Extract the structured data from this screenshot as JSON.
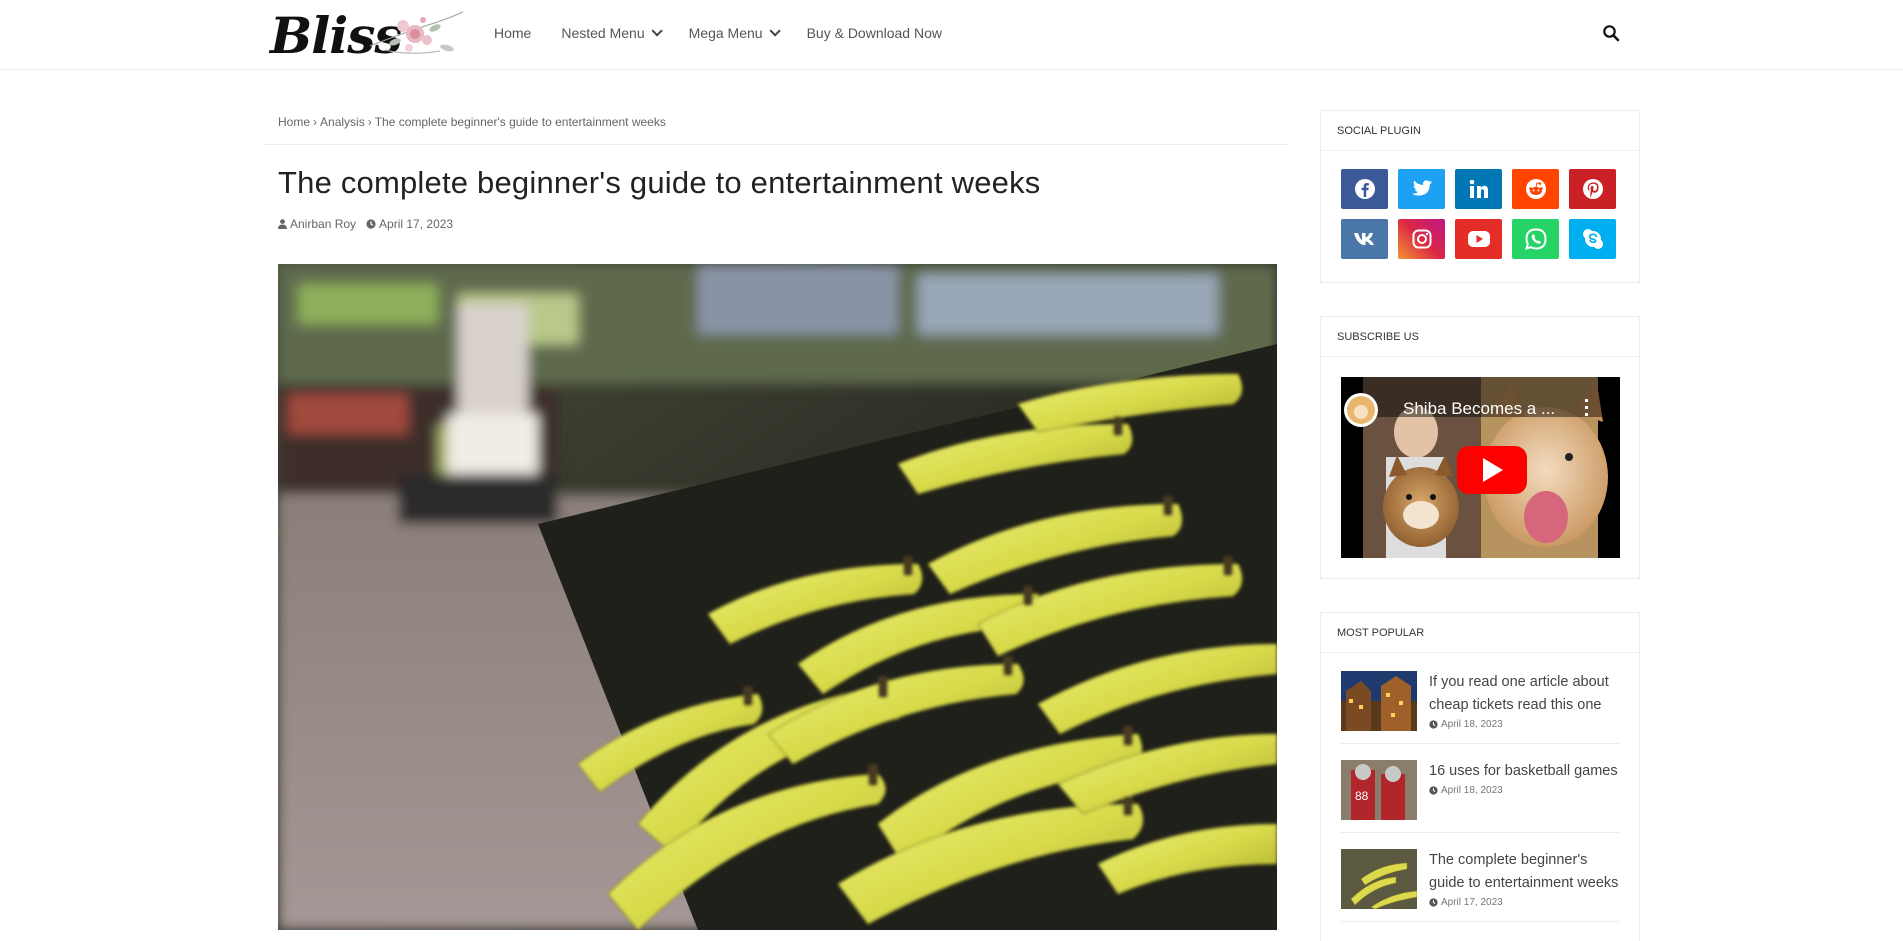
{
  "header": {
    "logo_text": "Bliss",
    "nav": [
      {
        "label": "Home"
      },
      {
        "label": "Nested Menu"
      },
      {
        "label": "Mega Menu"
      },
      {
        "label": "Buy & Download Now"
      }
    ]
  },
  "breadcrumb": {
    "home": "Home",
    "category": "Analysis",
    "current": "The complete beginner's guide to entertainment weeks",
    "separator": "›"
  },
  "post": {
    "title": "The complete beginner's guide to entertainment weeks",
    "author": "Anirban Roy",
    "date": "April 17, 2023"
  },
  "sidebar": {
    "social_title": "Social Plugin",
    "social": [
      {
        "name": "facebook",
        "color": "#3b5998"
      },
      {
        "name": "twitter",
        "color": "#1da1f2"
      },
      {
        "name": "linkedin",
        "color": "#0077b5"
      },
      {
        "name": "reddit",
        "color": "#ff4500"
      },
      {
        "name": "pinterest",
        "color": "#ca2127"
      },
      {
        "name": "vk",
        "color": "#4a76a8"
      },
      {
        "name": "instagram",
        "color": "#c13584"
      },
      {
        "name": "youtube",
        "color": "#e52d27"
      },
      {
        "name": "whatsapp",
        "color": "#25d366"
      },
      {
        "name": "skype",
        "color": "#00aff0"
      }
    ],
    "subscribe_title": "Subscribe Us",
    "video_title": "Shiba Becomes a ...",
    "popular_title": "Most Popular",
    "popular": [
      {
        "title": "If you read one article about cheap tickets read this one",
        "date": "April 18, 2023"
      },
      {
        "title": "16 uses for basketball games",
        "date": "April 18, 2023"
      },
      {
        "title": "The complete beginner's guide to entertainment weeks",
        "date": "April 17, 2023"
      }
    ]
  }
}
